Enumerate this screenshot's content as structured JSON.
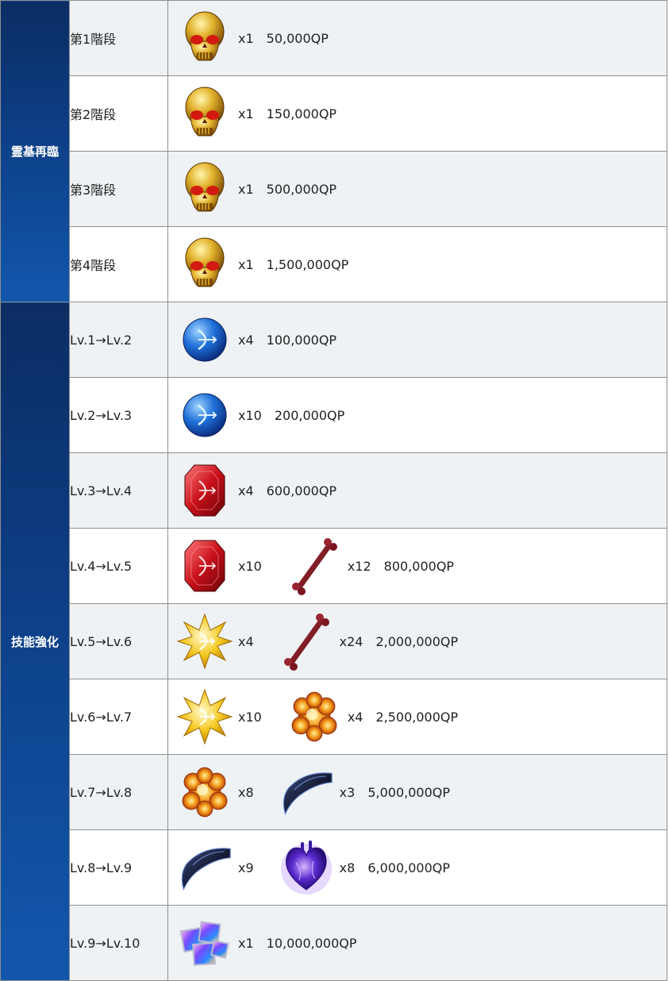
{
  "groups": {
    "ascension": "霊基再臨",
    "skill": "技能強化"
  },
  "rows": [
    {
      "stage": "第1階段",
      "items": [
        {
          "icon": "gold-skull-icon",
          "qty": "x1"
        }
      ],
      "qp": "50,000QP"
    },
    {
      "stage": "第2階段",
      "items": [
        {
          "icon": "gold-skull-icon",
          "qty": "x1"
        }
      ],
      "qp": "150,000QP"
    },
    {
      "stage": "第3階段",
      "items": [
        {
          "icon": "gold-skull-icon",
          "qty": "x1"
        }
      ],
      "qp": "500,000QP"
    },
    {
      "stage": "第4階段",
      "items": [
        {
          "icon": "gold-skull-icon",
          "qty": "x1"
        }
      ],
      "qp": "1,500,000QP"
    },
    {
      "stage": "Lv.1→Lv.2",
      "items": [
        {
          "icon": "archer-gem-icon",
          "qty": "x4"
        }
      ],
      "qp": "100,000QP"
    },
    {
      "stage": "Lv.2→Lv.3",
      "items": [
        {
          "icon": "archer-gem-icon",
          "qty": "x10"
        }
      ],
      "qp": "200,000QP"
    },
    {
      "stage": "Lv.3→Lv.4",
      "items": [
        {
          "icon": "archer-magic-gem-icon",
          "qty": "x4"
        }
      ],
      "qp": "600,000QP"
    },
    {
      "stage": "Lv.4→Lv.5",
      "items": [
        {
          "icon": "archer-magic-gem-icon",
          "qty": "x10"
        },
        {
          "icon": "bone-icon",
          "qty": "x12"
        }
      ],
      "qp": "800,000QP"
    },
    {
      "stage": "Lv.5→Lv.6",
      "items": [
        {
          "icon": "archer-secret-gem-icon",
          "qty": "x4"
        },
        {
          "icon": "bone-icon",
          "qty": "x24"
        }
      ],
      "qp": "2,000,000QP"
    },
    {
      "stage": "Lv.6→Lv.7",
      "items": [
        {
          "icon": "archer-secret-gem-icon",
          "qty": "x10"
        },
        {
          "icon": "phoenix-feather-icon",
          "qty": "x4"
        }
      ],
      "qp": "2,500,000QP"
    },
    {
      "stage": "Lv.7→Lv.8",
      "items": [
        {
          "icon": "phoenix-feather-icon",
          "qty": "x8"
        },
        {
          "icon": "claw-icon",
          "qty": "x3"
        }
      ],
      "qp": "5,000,000QP"
    },
    {
      "stage": "Lv.8→Lv.9",
      "items": [
        {
          "icon": "claw-icon",
          "qty": "x9"
        },
        {
          "icon": "heart-icon",
          "qty": "x8"
        }
      ],
      "qp": "6,000,000QP"
    },
    {
      "stage": "Lv.9→Lv.10",
      "items": [
        {
          "icon": "crystal-cube-icon",
          "qty": "x1"
        }
      ],
      "qp": "10,000,000QP"
    }
  ],
  "colors": {
    "group_bg": "#0d3f87",
    "alt_row_bg": "#eef2f4",
    "border": "#8f8f8f"
  }
}
